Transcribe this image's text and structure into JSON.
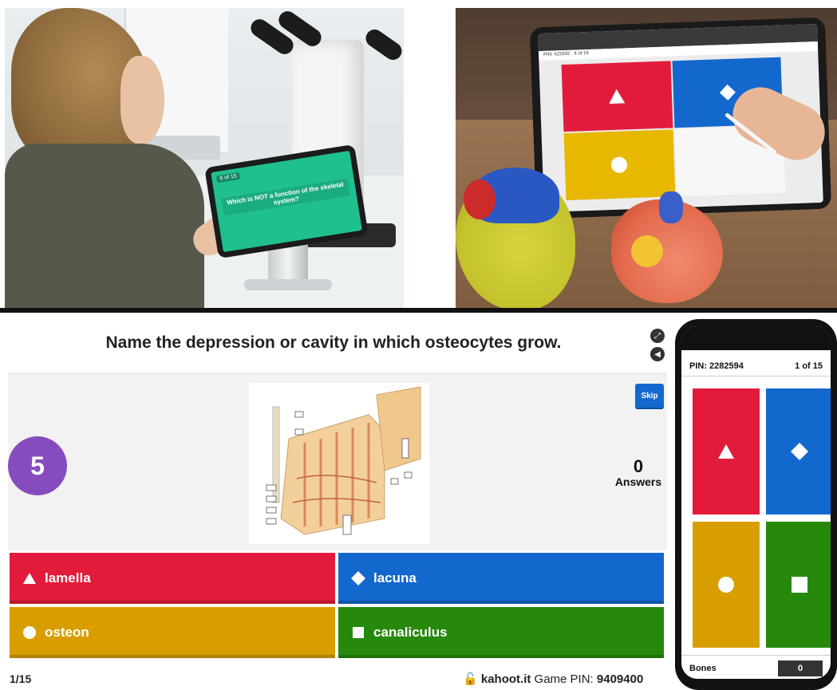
{
  "photos": {
    "left": {
      "tablet_counter": "6 of 15",
      "tablet_question": "Which is NOT a function of the skeletal system?"
    },
    "right": {
      "tablet_pin_label": "PIN: 422932",
      "tablet_counter": "4 of 15"
    }
  },
  "host": {
    "question": "Name the depression or cavity in which osteocytes grow.",
    "timer": "5",
    "skip_label": "Skip",
    "answers_count": "0",
    "answers_label": "Answers",
    "options": [
      {
        "label": "lamella",
        "color": "#e21b3c",
        "shape": "triangle-icon"
      },
      {
        "label": "lacuna",
        "color": "#1368ce",
        "shape": "diamond-icon"
      },
      {
        "label": "osteon",
        "color": "#d89e00",
        "shape": "circle-icon"
      },
      {
        "label": "canaliculus",
        "color": "#26890c",
        "shape": "square-icon"
      }
    ],
    "progress": "1/15",
    "site": "kahoot.it",
    "game_pin_label": "Game PIN:",
    "game_pin": "9409400"
  },
  "phone": {
    "pin": "PIN: 2282594",
    "counter": "1 of 15",
    "player_name": "Bones",
    "score": "0"
  },
  "colors": {
    "purple": "#864cbf",
    "red": "#e21b3c",
    "blue": "#1368ce",
    "yellow": "#d89e00",
    "green": "#26890c"
  }
}
